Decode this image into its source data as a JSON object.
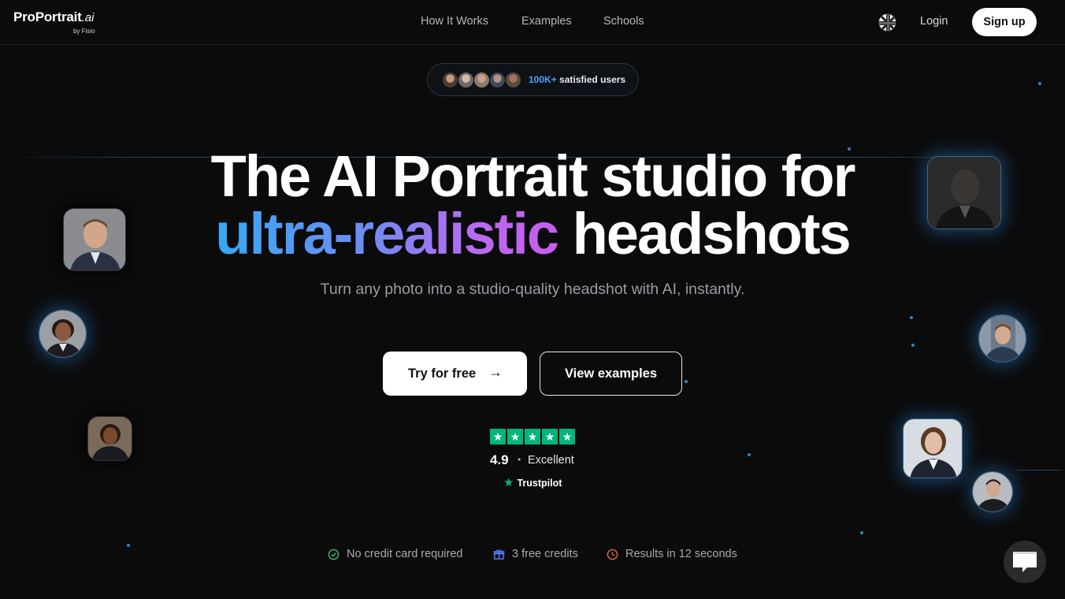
{
  "brand": {
    "name": "ProPortrait",
    "suffix": ".ai",
    "byline": "by Fisio"
  },
  "nav": {
    "links": [
      "How It Works",
      "Examples",
      "Schools"
    ],
    "language_icon": "uk-flag-icon",
    "login": "Login",
    "signup": "Sign up"
  },
  "social_proof": {
    "count": "100K+",
    "label": "satisfied users"
  },
  "hero": {
    "line1": "The AI Portrait studio for",
    "highlight": "ultra-realistic",
    "line2_rest": " headshots",
    "subtitle": "Turn any photo into a studio-quality headshot with AI, instantly."
  },
  "cta": {
    "primary": "Try for free",
    "primary_icon": "arrow-right-icon",
    "secondary": "View examples"
  },
  "rating": {
    "stars": 5,
    "score": "4.9",
    "label": "Excellent",
    "provider": "Trustpilot"
  },
  "features": [
    {
      "text": "No credit card required",
      "icon": "check-circle-icon",
      "color": "#3fbf6a"
    },
    {
      "text": "3 free credits",
      "icon": "gift-icon",
      "color": "#5a7cff"
    },
    {
      "text": "Results in 12 seconds",
      "icon": "clock-icon",
      "color": "#e86a4a"
    }
  ],
  "colors": {
    "background": "#0b0b0c",
    "accent_blue": "#4aa3ff",
    "gradient_start": "#36a8f4",
    "gradient_end": "#c75ded",
    "trustpilot_green": "#00b67a"
  }
}
